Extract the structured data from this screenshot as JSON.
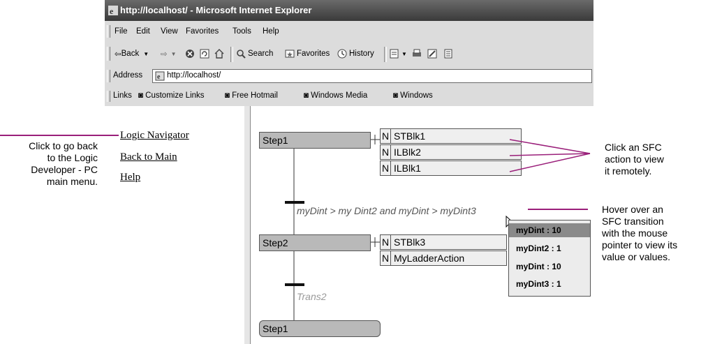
{
  "window": {
    "title": "http://localhost/ - Microsoft Internet Explorer"
  },
  "menu": [
    "File",
    "Edit",
    "View",
    "Favorites",
    "Tools",
    "Help"
  ],
  "toolbar": {
    "back": "Back",
    "search": "Search",
    "favorites": "Favorites",
    "history": "History"
  },
  "address": {
    "label": "Address",
    "value": "http://localhost/"
  },
  "links": {
    "label": "Links",
    "items": [
      "Customize Links",
      "Free Hotmail",
      "Windows Media",
      "Windows"
    ]
  },
  "nav": {
    "items": [
      "Logic Navigator",
      "Back to Main",
      "Help"
    ]
  },
  "sfc": {
    "step1": "Step1",
    "actions1": [
      {
        "q": "N",
        "name": "STBlk1"
      },
      {
        "q": "N",
        "name": "ILBlk2"
      },
      {
        "q": "N",
        "name": "ILBlk1"
      }
    ],
    "transition1": "myDint > my Dint2 and myDint > myDint3",
    "step2": "Step2",
    "actions2": [
      {
        "q": "N",
        "name": "STBlk3"
      },
      {
        "q": "N",
        "name": "MyLadderAction"
      }
    ],
    "transition2": "Trans2",
    "step3": "Step1"
  },
  "tooltip": [
    "myDint : 10",
    "myDint2 : 1",
    "myDint : 10",
    "myDint3 : 1"
  ],
  "callouts": {
    "left": [
      "Click to go back",
      "to the Logic",
      "Developer - PC",
      "main menu."
    ],
    "right_top": [
      "Click an SFC",
      "action to view",
      "it remotely."
    ],
    "right_mid": [
      "Hover over an",
      "SFC transition",
      "with the mouse",
      "pointer to view its",
      "value or values."
    ]
  },
  "colors": {
    "callout_line": "#9a1f7a",
    "step_fill": "#b9b9b9",
    "titlebar": "#3a3a3a"
  }
}
